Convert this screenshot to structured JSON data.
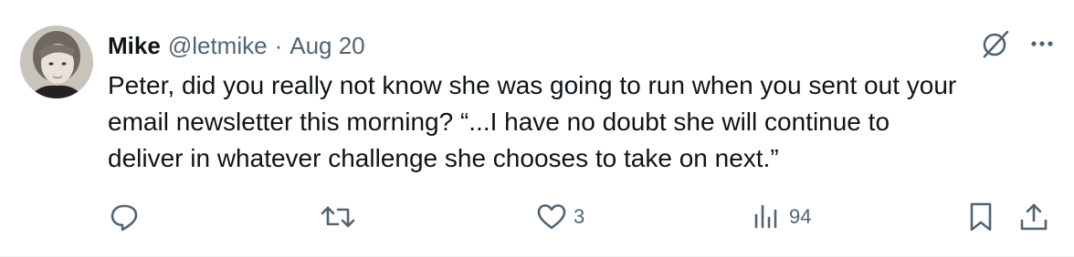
{
  "post": {
    "author_name": "Mike",
    "author_handle": "@letmike",
    "separator": "·",
    "date": "Aug 20",
    "text": "Peter, did you really not know she was going to run when you sent out your\nemail newsletter this morning?  “...I have no doubt she will continue to\ndeliver in whatever challenge she chooses to take on next.”"
  },
  "top_icons": [
    "grok-icon",
    "more-icon"
  ],
  "actions": {
    "reply": {
      "icon": "reply-icon",
      "count": ""
    },
    "repost": {
      "icon": "repost-icon",
      "count": ""
    },
    "like": {
      "icon": "heart-icon",
      "count": "3"
    },
    "views": {
      "icon": "views-icon",
      "count": "94"
    },
    "bookmark": {
      "icon": "bookmark-icon"
    },
    "share": {
      "icon": "share-icon"
    }
  },
  "colors": {
    "text": "#0f1419",
    "secondary": "#536471",
    "divider": "#eff3f4"
  }
}
